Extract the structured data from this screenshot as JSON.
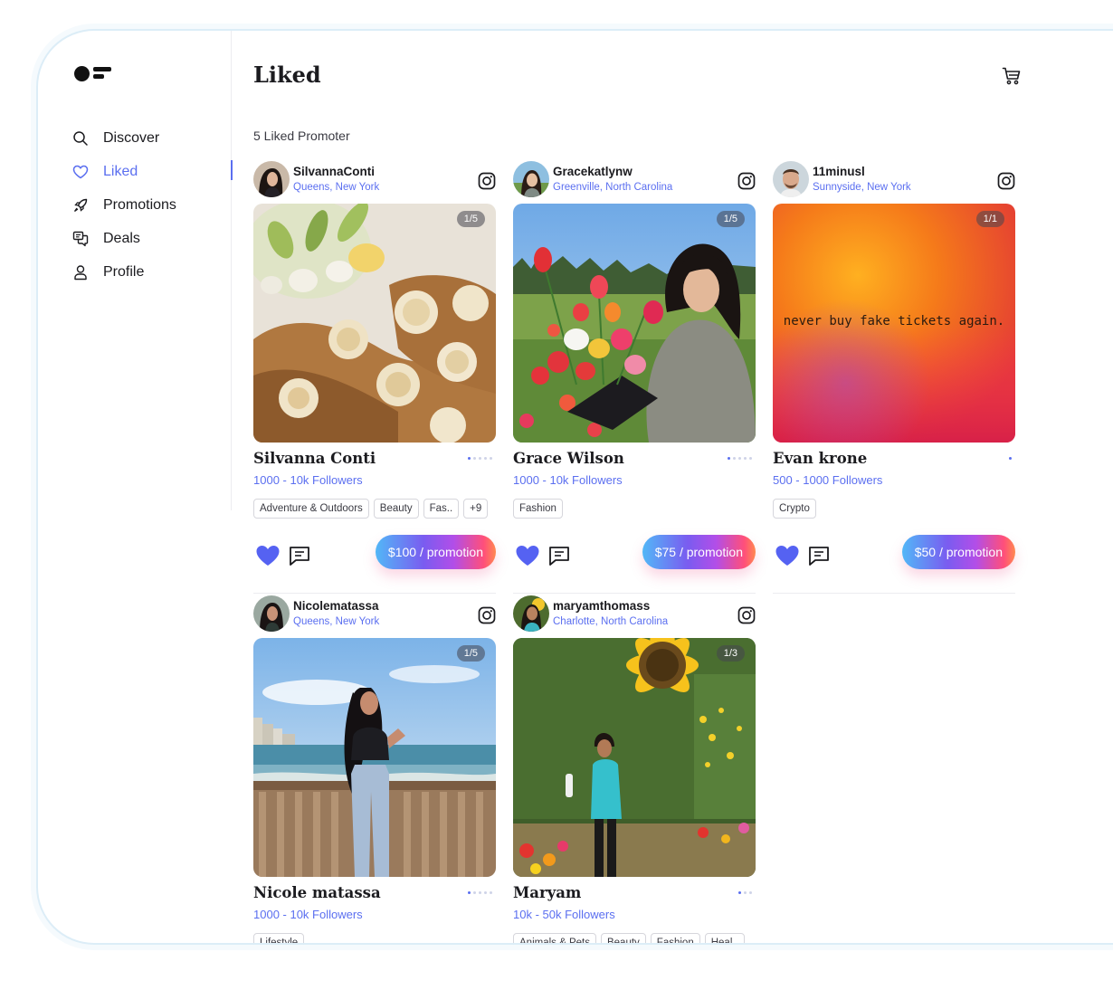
{
  "sidebar": {
    "items": [
      {
        "label": "Discover",
        "icon": "search-icon"
      },
      {
        "label": "Liked",
        "icon": "heart-outline-icon",
        "active": true
      },
      {
        "label": "Promotions",
        "icon": "rocket-icon"
      },
      {
        "label": "Deals",
        "icon": "chat-bubbles-icon"
      },
      {
        "label": "Profile",
        "icon": "user-icon"
      }
    ]
  },
  "header": {
    "title": "Liked",
    "cart_icon": "cart-icon"
  },
  "main": {
    "count_label": "5 Liked Promoter",
    "accent": "#5b6ff0",
    "cards": [
      {
        "handle": "SilvannaConti",
        "location": "Queens, New York",
        "pager": "1/5",
        "name": "Silvanna Conti",
        "followers": "1000 - 10k Followers",
        "tags": [
          "Adventure & Outdoors",
          "Beauty",
          "Fas..",
          "+9"
        ],
        "price": "$100 / promotion"
      },
      {
        "handle": "Gracekatlynw",
        "location": "Greenville, North Carolina",
        "pager": "1/5",
        "name": "Grace Wilson",
        "followers": "1000 - 10k Followers",
        "tags": [
          "Fashion"
        ],
        "price": "$75 / promotion"
      },
      {
        "handle": "11minusl",
        "location": "Sunnyside, New York",
        "pager": "1/1",
        "name": "Evan krone",
        "followers": "500 - 1000 Followers",
        "tags": [
          "Crypto"
        ],
        "price": "$50 / promotion",
        "quote": "never buy fake tickets again."
      },
      {
        "handle": "Nicolematassa",
        "location": "Queens, New York",
        "pager": "1/5",
        "name": "Nicole matassa",
        "followers": "1000 - 10k Followers",
        "tags": [
          "Lifestyle"
        ]
      },
      {
        "handle": "maryamthomass",
        "location": "Charlotte, North Carolina",
        "pager": "1/3",
        "name": "Maryam",
        "followers": "10k - 50k Followers",
        "tags": [
          "Animals & Pets",
          "Beauty",
          "Fashion",
          "Heal.."
        ]
      }
    ]
  }
}
